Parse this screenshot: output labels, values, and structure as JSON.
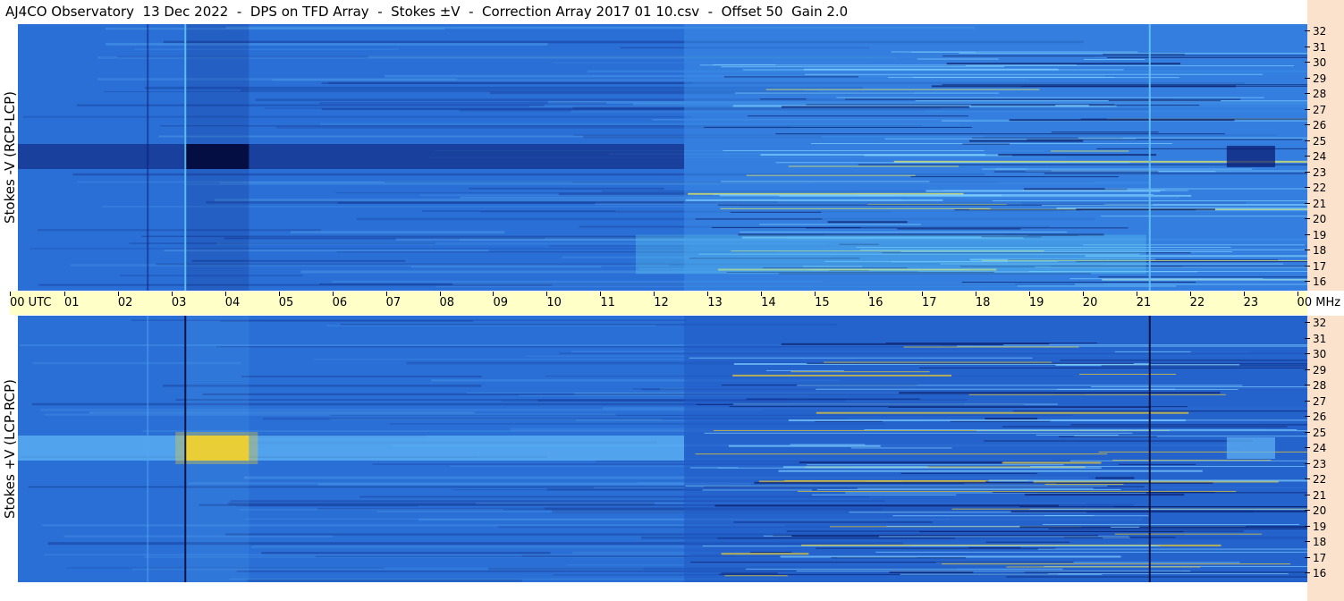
{
  "title": "AJ4CO Observatory  13 Dec 2022  -  DPS on TFD Array  -  Stokes ±V  -  Correction Array 2017 01 10.csv  -  Offset 50  Gain 2.0",
  "chart_data": [
    {
      "type": "heatmap",
      "panel": "top",
      "ylabel": "Stokes -V (RCP-LCP)",
      "x_ticks": [
        "00 UTC",
        "01",
        "02",
        "03",
        "04",
        "05",
        "06",
        "07",
        "08",
        "09",
        "10",
        "11",
        "12",
        "13",
        "14",
        "15",
        "16",
        "17",
        "18",
        "19",
        "20",
        "21",
        "22",
        "23",
        "00"
      ],
      "xlim": [
        0,
        24
      ],
      "y_ticks": [
        "32",
        "31",
        "30",
        "29",
        "28",
        "27",
        "26",
        "25",
        "24",
        "23",
        "22",
        "21",
        "20",
        "19",
        "18",
        "17",
        "16"
      ],
      "ylim": [
        16,
        32
      ],
      "y_unit": "MHz",
      "features": {
        "dark_band_center_mhz": 24,
        "intense_window_utc": [
          3.1,
          4.3
        ],
        "vertical_lines_utc": [
          3.1,
          21.05
        ],
        "interference_start_utc": 12.4
      },
      "colors": {
        "base": "#2a6fd6",
        "dark": "#0a1a6e",
        "light": "#5fb4f5",
        "hot": "#f3f15a"
      }
    },
    {
      "type": "heatmap",
      "panel": "bottom",
      "ylabel": "Stokes +V (LCP-RCP)",
      "x_ticks": [
        "00 UTC",
        "01",
        "02",
        "03",
        "04",
        "05",
        "06",
        "07",
        "08",
        "09",
        "10",
        "11",
        "12",
        "13",
        "14",
        "15",
        "16",
        "17",
        "18",
        "19",
        "20",
        "21",
        "22",
        "23",
        "00"
      ],
      "xlim": [
        0,
        24
      ],
      "y_ticks": [
        "32",
        "31",
        "30",
        "29",
        "28",
        "27",
        "26",
        "25",
        "24",
        "23",
        "22",
        "21",
        "20",
        "19",
        "18",
        "17",
        "16"
      ],
      "ylim": [
        16,
        32
      ],
      "y_unit": "MHz",
      "features": {
        "bright_band_center_mhz": 24,
        "intense_window_utc": [
          3.1,
          4.3
        ],
        "vertical_lines_utc": [
          3.1,
          21.05
        ],
        "interference_start_utc": 12.4
      },
      "colors": {
        "base": "#2a6fd6",
        "dark": "#0a1a6e",
        "light": "#5fb4f5",
        "hot": "#f3d02a"
      }
    }
  ],
  "time_axis": {
    "labels": [
      "00  UTC",
      "01",
      "02",
      "03",
      "04",
      "05",
      "06",
      "07",
      "08",
      "09",
      "10",
      "11",
      "12",
      "13",
      "14",
      "15",
      "16",
      "17",
      "18",
      "19",
      "20",
      "21",
      "22",
      "23",
      "00 MHz"
    ]
  }
}
